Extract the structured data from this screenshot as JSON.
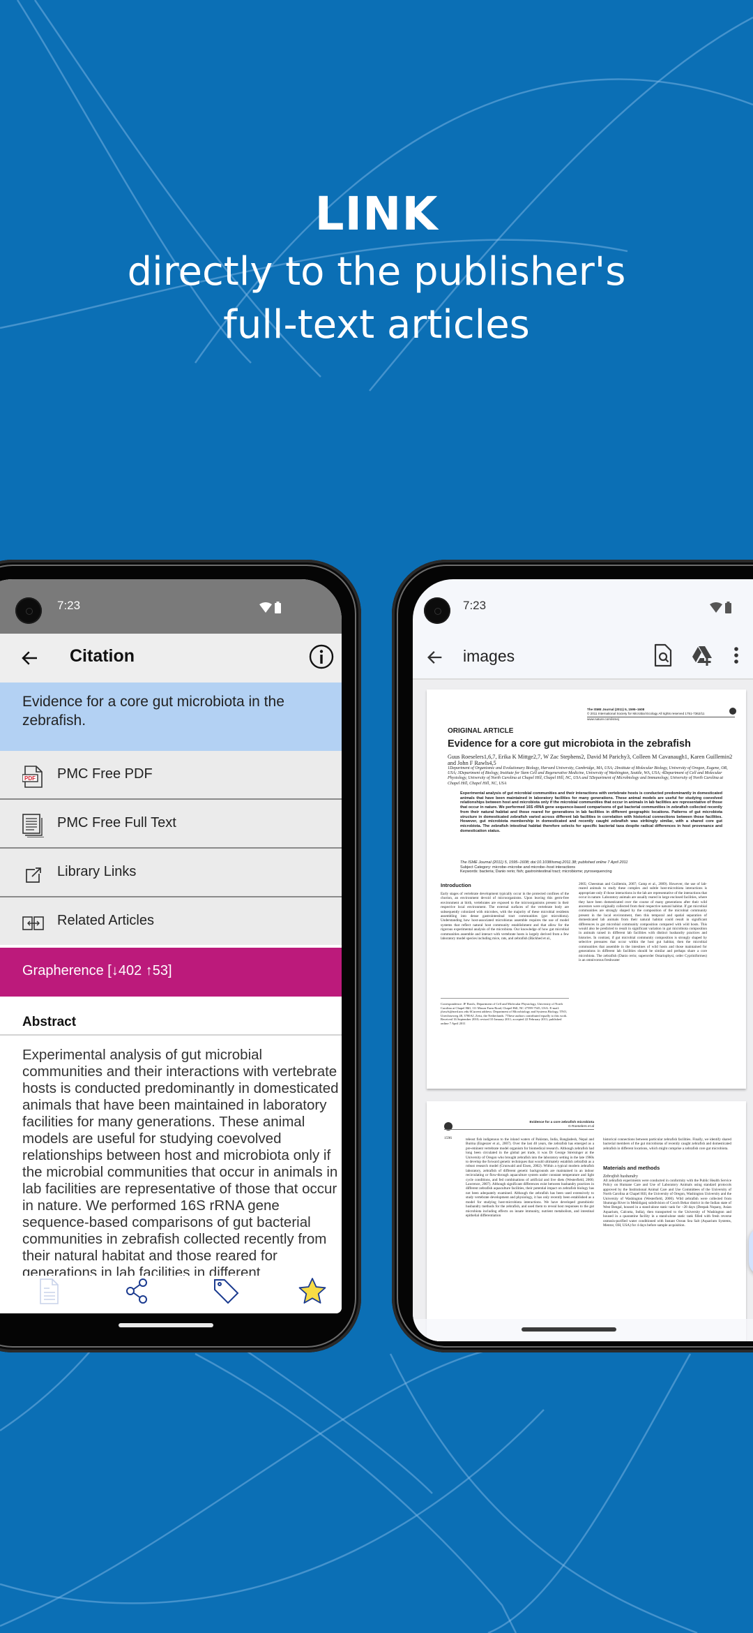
{
  "hero": {
    "title": "LINK",
    "subtitle_line1": "directly to the publisher's",
    "subtitle_line2": "full-text articles"
  },
  "colors": {
    "background": "#0b6fb5",
    "citation_highlight": "#b3d1f3",
    "grapherence": "#bc1a7b",
    "nav_icon": "#1a3a8f",
    "star_fill": "#f7dc45",
    "fab": "#d3e3fd"
  },
  "left_phone": {
    "status": {
      "time": "7:23",
      "icons": [
        "wifi-icon",
        "battery-icon"
      ]
    },
    "appbar": {
      "title": "Citation",
      "back_icon": "arrow-left-icon",
      "info_icon": "info-icon"
    },
    "citation_title": "Evidence for a core gut microbiota in the zebrafish.",
    "links": [
      {
        "label": "PMC Free PDF",
        "icon": "pdf-icon"
      },
      {
        "label": "PMC Free Full Text",
        "icon": "full-text-icon"
      },
      {
        "label": "Library Links",
        "icon": "external-link-icon"
      },
      {
        "label": "Related Articles",
        "icon": "related-articles-icon"
      }
    ],
    "grapherence": "Grapherence [↓402 ↑53]",
    "abstract_heading": "Abstract",
    "abstract_text": "Experimental analysis of gut microbial communities and their interactions with vertebrate hosts is conducted predominantly in domesticated animals that have been maintained in laboratory facilities for many generations. These animal models are useful for studying coevolved relationships between host and microbiota only if the microbial communities that occur in animals in lab facilities are representative of those that occur in nature. We performed 16S rRNA gene sequence-based comparisons of gut bacterial communities in zebrafish collected recently from their natural habitat and those reared for generations in lab facilities in different",
    "bottom_nav": [
      "document-icon",
      "share-icon",
      "tag-icon",
      "star-icon"
    ]
  },
  "right_phone": {
    "status": {
      "time": "7:23",
      "icons": [
        "wifi-icon",
        "battery-icon"
      ]
    },
    "appbar": {
      "title": "images",
      "actions": [
        "search-document-icon",
        "drive-add-icon",
        "more-vert-icon"
      ]
    },
    "page1": {
      "journal_line1": "The ISME Journal (2011) 5, 1595–1608",
      "journal_line2": "© 2011 International Society for Microbial Ecology  All rights reserved 1751-7362/11",
      "journal_line3": "www.nature.com/ismej",
      "section": "ORIGINAL ARTICLE",
      "title": "Evidence for a core gut microbiota in the zebrafish",
      "authors": "Guus Roeselers1,6,7, Erika K Mittge2,7, W Zac Stephens2, David M Parichy3, Colleen M Cavanaugh1, Karen Guillemin2 and John F Rawls4,5",
      "affiliations": "1Department of Organismic and Evolutionary Biology, Harvard University, Cambridge, MA, USA; 2Institute of Molecular Biology, University of Oregon, Eugene, OR, USA; 3Department of Biology, Institute for Stem Cell and Regenerative Medicine, University of Washington, Seattle, WA, USA; 4Department of Cell and Molecular Physiology, University of North Carolina at Chapel Hill, Chapel Hill, NC, USA and 5Department of Microbiology and Immunology, University of North Carolina at Chapel Hill, Chapel Hill, NC, USA",
      "abstract": "Experimental analysis of gut microbial communities and their interactions with vertebrate hosts is conducted predominantly in domesticated animals that have been maintained in laboratory facilities for many generations. These animal models are useful for studying coevolved relationships between host and microbiota only if the microbial communities that occur in animals in lab facilities are representative of those that occur in nature. We performed 16S rRNA gene sequence-based comparisons of gut bacterial communities in zebrafish collected recently from their natural habitat and those reared for generations in lab facilities in different geographic locations. Patterns of gut microbiota structure in domesticated zebrafish varied across different lab facilities in correlation with historical connections between those facilities. However, gut microbiota membership in domesticated and recently caught zebrafish was strikingly similar, with a shared core gut microbiota. The zebrafish intestinal habitat therefore selects for specific bacterial taxa despite radical differences in host provenance and domestication status.",
      "citation_line": "The ISME Journal (2011) 5, 1595–1608; doi:10.1038/ismej.2011.38; published online 7 April 2011",
      "subject_category": "Subject Category: microbe–microbe and microbe–host interactions",
      "keywords": "Keywords: bacteria; Danio rerio; fish; gastrointestinal tract; microbiome; pyrosequencing",
      "intro_heading": "Introduction",
      "intro_col1": "Early stages of vertebrate development typically occur in the protected confines of the chorion, an environment devoid of microorganisms. Upon leaving this germ-free environment at birth, vertebrates are exposed to the microorganisms present in their respective local environment. The external surfaces of the vertebrate body are subsequently colonized with microbes, with the majority of these microbial residents assembling into dense gastrointestinal tract communities (gut microbiota). Understanding how host-associated microbiotas assemble requires the use of model systems that reflect natural host community establishment and that allow for the rigorous experimental analysis of the microbiota. Our knowledge of how gut microbial communities assemble and interact with vertebrate hosts is largely derived from a few laboratory model species including mice, rats, and zebrafish (Bäckhed et al.,",
      "intro_col2": "2005; Cheesman and Guillemin, 2007; Camp et al., 2009). However, the use of lab-reared animals to study these complex and subtle host-microbiota interactions is appropriate only if those interactions in the lab are representative of the interactions that occur in nature. Laboratory animals are usually reared in large enclosed facilities, where they have been domesticated over the course of many generations after their wild ancestors were originally collected from their respective natural habitat. If gut microbial communities are strongly shaped by the composition of the microbial community present in the local environment, then this temporal and spatial separation of domesticated lab animals from their natural habitat could result in significant differences in gut microbial community composition compared with wild hosts. This would also be predicted to result in significant variation in gut microbiota composition in animals raised in different lab facilities with distinct husbandry practices and histories. In contrast, if gut microbial community composition is strongly shaped by selective pressures that occur within the host gut habitat, then the microbial communities that assemble in the intestines of wild hosts and those maintained for generations in different lab facilities should be similar and perhaps share a core microbiota. The zebrafish (Danio rerio; superorder Ostariophysi, order Cypriniformes) is an omnivorous freshwater",
      "footnote": "Correspondence: JF Rawls, Department of Cell and Molecular Physiology, University of North Carolina at Chapel Hill, 111 Mason Farm Road, Chapel Hill, NC 27599-7545, USA. E-mail: jfrawls@med.unc.edu 6Current address: Department of Microbiology and Systems Biology, TNO, Utrechtseweg 48, 3700AJ, Zeist, the Netherlands. 7These authors contributed equally to this work. Received 16 September 2010; revised 10 January 2011; accepted 22 February 2011; published online 7 April 2011"
    },
    "page2": {
      "running_head1": "Evidence for a core zebrafish microbiota",
      "running_head2": "G Roeselers et al",
      "page_number": "1596",
      "col1": "teleost fish indigenous to the inland waters of Pakistan, India, Bangladesh, Nepal and Burma (Engeszer et al., 2007). Over the last 40 years, the zebrafish has emerged as a pre-eminent vertebrate model organism for biomedical research. Although zebrafish had long been circulated in the global pet trade, it was Dr George Streisinger at the University of Oregon who brought zebrafish into the laboratory setting in the late 1960s to develop the forward genetic techniques that would ultimately establish zebrafish as a robust research model (Grunwald and Eisen, 2002). Within a typical modern zebrafish laboratory, zebrafish of different genetic backgrounds are maintained in an indoor recirculating or flow-through aquaculture system under constant temperature and light cycle conditions, and fed combinations of artificial and live diets (Westerfield, 2000; Lawrence, 2007). Although significant differences exist between husbandry practices in different zebrafish aquaculture facilities, their potential impact on zebrafish biology has not been adequately examined. Although the zebrafish has been used extensively to study vertebrate development and physiology, it has only recently been established as a model for studying host-microbiota interactions. We have developed gnotobiotic husbandry methods for the zebrafish, and used them to reveal host responses to the gut microbiota including effects on innate immunity, nutrient metabolism, and intestinal epithelial differentiation",
      "col2_intro": "historical connections between particular zebrafish facilities. Finally, we identify shared bacterial members of the gut microbiotas of recently caught zebrafish and domesticated zebrafish in different locations, which might comprise a zebrafish core gut microbiota.",
      "methods_heading": "Materials and methods",
      "methods_subheading": "Zebrafish husbandry",
      "col2_methods": "All zebrafish experiments were conducted in conformity with the Public Health Service Policy on Humane Care and Use of Laboratory Animals using standard protocols approved by the Institutional Animal Care and Use Committees of the University of North Carolina at Chapel Hill, the University of Oregon, Washington University and the University of Washington (Westerfield, 2000). Wild zebrafish were collected from Shutunga River in Mekhliganj subdivision of Cooch Behar district in the Indian state of West Bengal, housed in a stand-alone static tank for ~28 days (Deepak Nopany, Asian Aquarium, Calcutta, India), then transported to the University of Washington and housed in a quarantine facility in a stand-alone static tank filled with fresh reverse osmosis-purified water conditioned with Instant Ocean Sea Salt (Aquarium Systems, Mentor, OH, USA) for 4 days before sample acquisition."
    },
    "fab_icon": "edit-annotate-icon"
  }
}
